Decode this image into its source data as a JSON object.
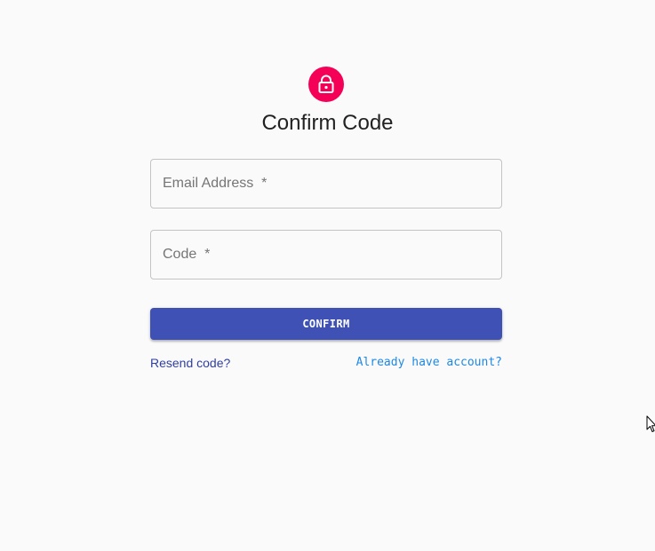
{
  "header": {
    "title": "Confirm Code",
    "icon": "lock-outline-icon",
    "icon_bg_color": "#f50057"
  },
  "form": {
    "email": {
      "placeholder": "Email Address  *",
      "value": ""
    },
    "code": {
      "placeholder": "Code  *",
      "value": ""
    },
    "confirm_label": "CONFIRM",
    "confirm_color": "#3f51b5"
  },
  "links": {
    "resend": "Resend code?",
    "have_account": "Already have account?"
  }
}
